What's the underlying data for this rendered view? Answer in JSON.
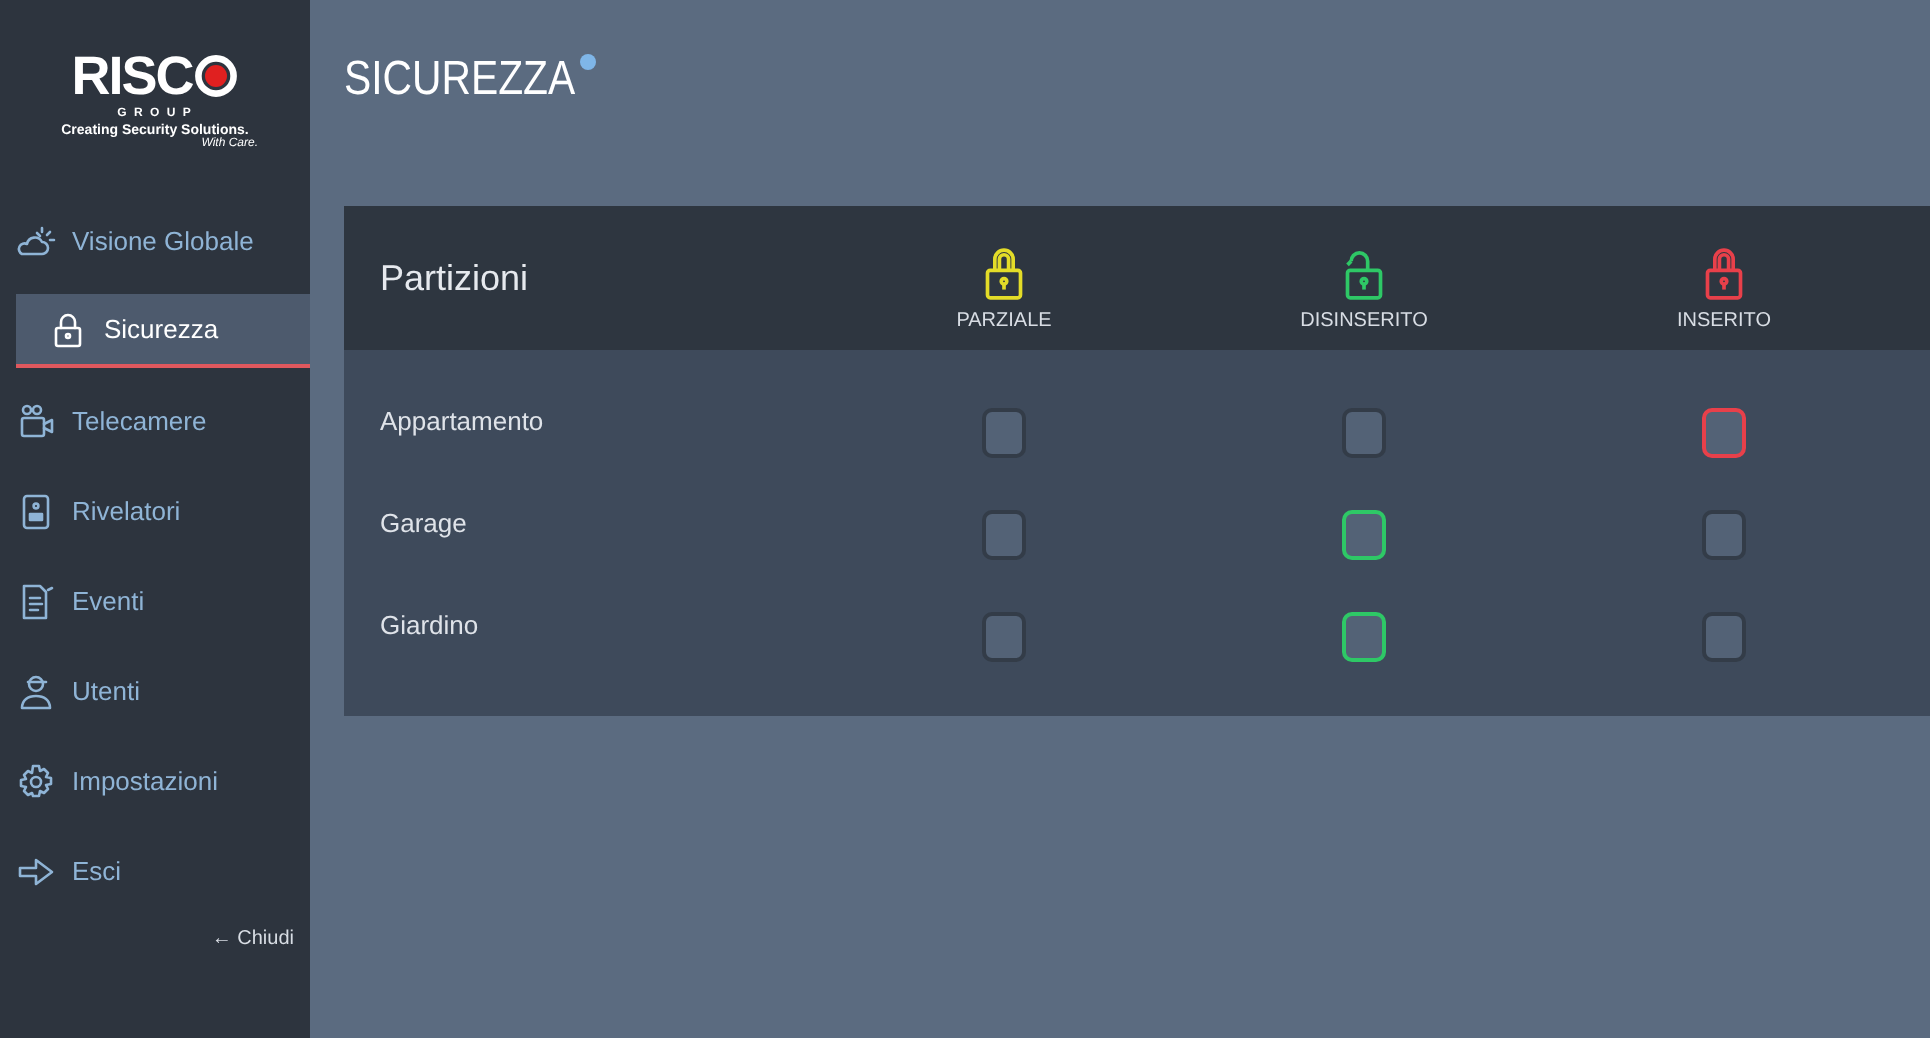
{
  "logo": {
    "name": "RISC",
    "group": "G R O U P",
    "tagline": "Creating Security Solutions.",
    "signature": "With Care."
  },
  "sidebar": {
    "items": [
      {
        "label": "Visione Globale",
        "kind": "weather",
        "selected": false
      },
      {
        "label": "Sicurezza",
        "kind": "lock",
        "selected": true
      },
      {
        "label": "Telecamere",
        "kind": "camera",
        "selected": false
      },
      {
        "label": "Rivelatori",
        "kind": "detector",
        "selected": false
      },
      {
        "label": "Eventi",
        "kind": "document",
        "selected": false
      },
      {
        "label": "Utenti",
        "kind": "user",
        "selected": false
      },
      {
        "label": "Impostazioni",
        "kind": "gear",
        "selected": false
      },
      {
        "label": "Esci",
        "kind": "exit",
        "selected": false
      }
    ],
    "close": "← Chiudi"
  },
  "page": {
    "title": "SICUREZZA",
    "help": true
  },
  "table": {
    "heading": "Partizioni",
    "columns": [
      {
        "label": "PARZIALE",
        "color": "#e3dc28",
        "kind": "closed"
      },
      {
        "label": "DISINSERITO",
        "color": "#2ec866",
        "kind": "open"
      },
      {
        "label": "INSERITO",
        "color": "#e8404a",
        "kind": "closed"
      }
    ],
    "rows": [
      {
        "name": "Appartamento",
        "cells": [
          {
            "selected": false
          },
          {
            "selected": false
          },
          {
            "selected": true
          }
        ]
      },
      {
        "name": "Garage",
        "cells": [
          {
            "selected": false
          },
          {
            "selected": true
          },
          {
            "selected": false
          }
        ]
      },
      {
        "name": "Giardino",
        "cells": [
          {
            "selected": false
          },
          {
            "selected": true
          },
          {
            "selected": false
          }
        ]
      }
    ]
  }
}
